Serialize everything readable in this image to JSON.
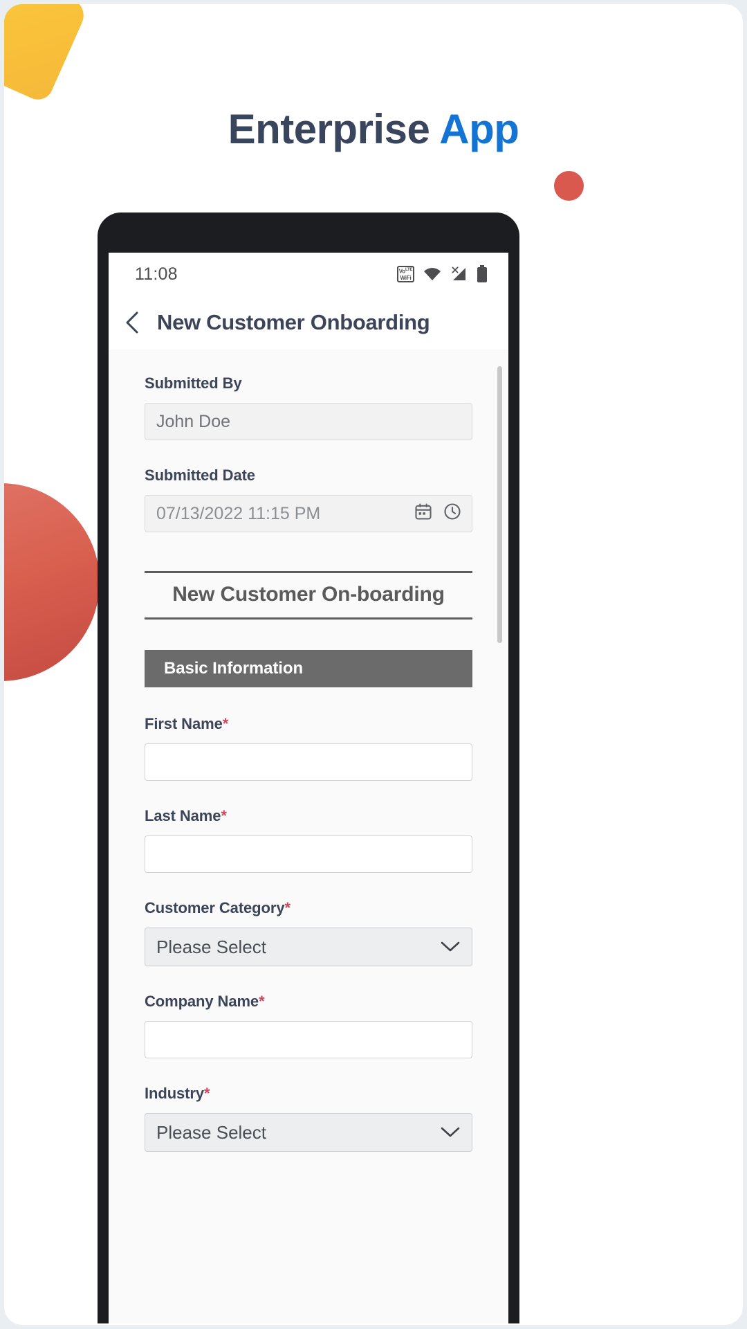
{
  "hero": {
    "title_main": "Enterprise",
    "title_accent": "App"
  },
  "phone": {
    "statusbar": {
      "time": "11:08",
      "icons": [
        {
          "name": "volte-icon",
          "line1": "Vo",
          "line2": "WiFi",
          "sup": "LTE"
        },
        {
          "name": "wifi-icon"
        },
        {
          "name": "signal-no-sim-icon"
        },
        {
          "name": "battery-icon"
        }
      ]
    },
    "appbar": {
      "back_icon": "back-chevron-icon",
      "title": "New Customer Onboarding"
    },
    "form": {
      "submitted_by": {
        "label": "Submitted By",
        "value": "John Doe"
      },
      "submitted_date": {
        "label": "Submitted Date",
        "value": "07/13/2022 11:15 PM",
        "icons": [
          "calendar-icon",
          "clock-icon"
        ]
      },
      "form_title": "New Customer On-boarding",
      "section_header": "Basic Information",
      "fields": [
        {
          "label": "First Name",
          "required": "*",
          "type": "text",
          "value": ""
        },
        {
          "label": "Last Name",
          "required": "*",
          "type": "text",
          "value": ""
        },
        {
          "label": "Customer Category",
          "required": "*",
          "type": "select",
          "value": "Please Select"
        },
        {
          "label": "Company Name",
          "required": "*",
          "type": "text",
          "value": ""
        },
        {
          "label": "Industry",
          "required": "*",
          "type": "select",
          "value": "Please Select"
        }
      ]
    }
  },
  "colors": {
    "accent_blue": "#1474d4",
    "heading_navy": "#39455c",
    "required_red": "#d1485b",
    "section_gray": "#6b6b6b",
    "blob_yellow": "#fbc93f",
    "blob_red": "#d9594f"
  }
}
